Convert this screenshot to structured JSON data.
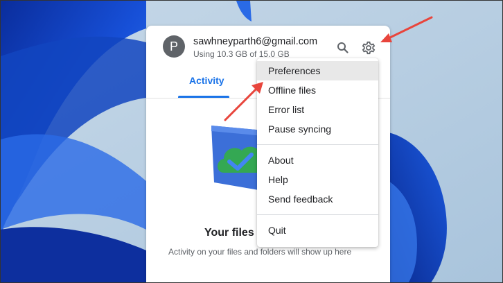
{
  "account": {
    "avatar_letter": "P",
    "email": "sawhneyparth6@gmail.com",
    "usage": "Using 10.3 GB of 15.0 GB"
  },
  "header": {
    "search_icon": "search-icon",
    "settings_icon": "gear-icon"
  },
  "tabs": [
    {
      "label": "Activity",
      "active": true
    }
  ],
  "empty_state": {
    "title": "Your files a",
    "description": "Activity on your files and folders will show up here"
  },
  "menu": {
    "items": [
      {
        "label": "Preferences",
        "selected": true
      },
      {
        "label": "Offline files"
      },
      {
        "label": "Error list"
      },
      {
        "label": "Pause syncing"
      },
      {
        "label": "About"
      },
      {
        "label": "Help"
      },
      {
        "label": "Send feedback"
      },
      {
        "label": "Quit"
      }
    ]
  },
  "colors": {
    "accent": "#1a73e8",
    "annotation_arrow": "#e8453c",
    "wallpaper_blue": "#1750d8"
  }
}
